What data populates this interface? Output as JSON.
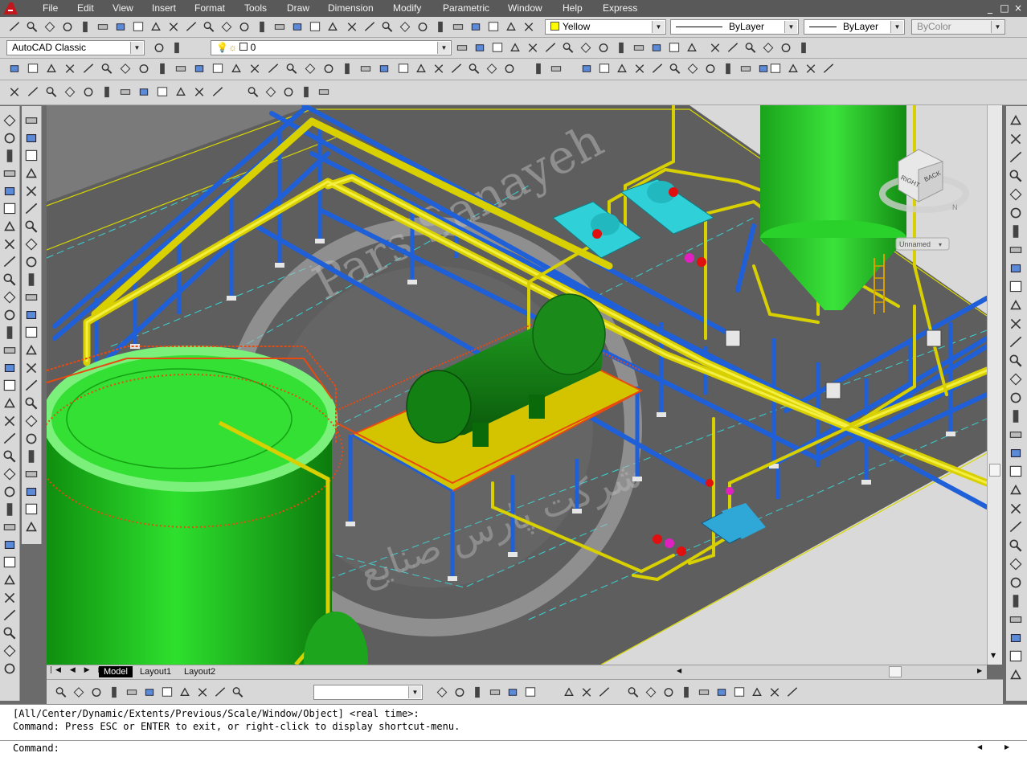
{
  "menu": {
    "items": [
      "File",
      "Edit",
      "View",
      "Insert",
      "Format",
      "Tools",
      "Draw",
      "Dimension",
      "Modify",
      "Parametric",
      "Window",
      "Help",
      "Express"
    ]
  },
  "window_controls": {
    "minimize": "_",
    "restore": "□",
    "close": "×"
  },
  "toolbar": {
    "color_value": "Yellow",
    "color_swatch": "#ffff00",
    "linetype_value": "ByLayer",
    "lineweight_value": "ByLayer",
    "plotstyle_value": "ByColor",
    "workspace_value": "AutoCAD Classic",
    "layer_value": "0",
    "view_value": ""
  },
  "viewport": {
    "viewcube": {
      "face_right": "RIGHT",
      "face_back": "BACK",
      "compass_n": "N"
    },
    "ucs_name": "Unnamed",
    "watermark": "Pars Sanayeh",
    "watermark_fa": "شرکت پارس صنایع"
  },
  "tabs": [
    {
      "label": "Model",
      "active": true
    },
    {
      "label": "Layout1",
      "active": false
    },
    {
      "label": "Layout2",
      "active": false
    }
  ],
  "command": {
    "history_1": "[All/Center/Dynamic/Extents/Previous/Scale/Window/Object] <real time>:",
    "history_2": "Command: Press ESC or ENTER to exit, or right-click to display shortcut-menu.",
    "prompt": "Command:"
  },
  "colors": {
    "pipe_yellow": "#e8e000",
    "steel_blue": "#1f5fd8",
    "tank_green": "#1fc21f",
    "vessel_green": "#1a8a1a",
    "pump_cyan": "#2fd0d8",
    "railing_orange": "#e84a10",
    "valve_magenta": "#e020c0",
    "valve_red": "#e01010"
  }
}
